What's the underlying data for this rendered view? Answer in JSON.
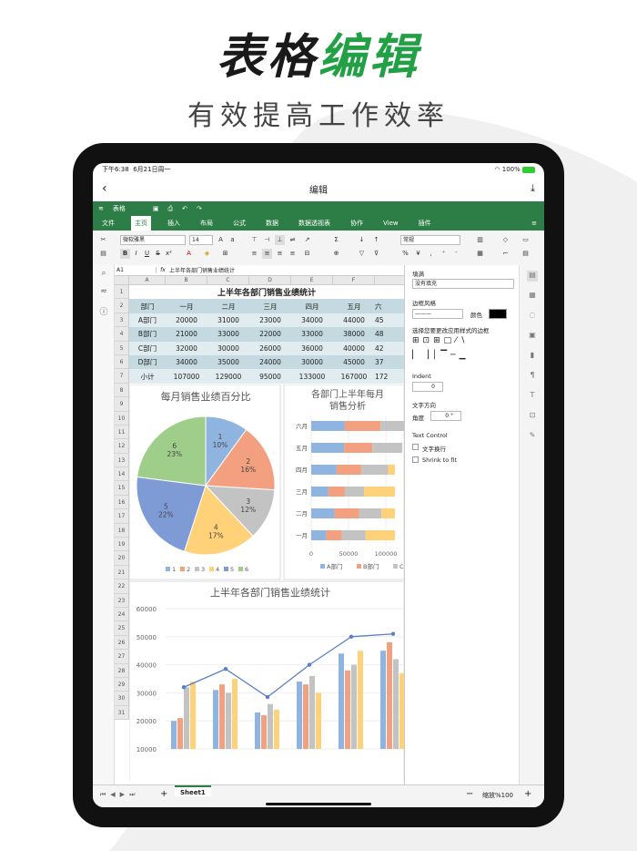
{
  "hero": {
    "title_black": "表格",
    "title_green": "编辑",
    "subtitle": "有效提高工作效率"
  },
  "status": {
    "time": "下午6:38",
    "date": "6月21日周一",
    "battery": "100%"
  },
  "nav": {
    "title": "编辑"
  },
  "app": {
    "name": "表格"
  },
  "ribbon_tabs": [
    "文件",
    "主页",
    "插入",
    "布局",
    "公式",
    "数据",
    "数据透视表",
    "协作",
    "View",
    "插件"
  ],
  "toolbar": {
    "font": "微软雅黑",
    "size": "14",
    "format": "常规"
  },
  "formula": {
    "cell": "A1",
    "fx": "fx",
    "value": "上半年各部门销售业绩统计"
  },
  "columns": [
    "A",
    "B",
    "C",
    "D",
    "E",
    "F"
  ],
  "rows": [
    "1",
    "2",
    "3",
    "4",
    "5",
    "6",
    "7",
    "8",
    "9",
    "10",
    "11",
    "12",
    "13",
    "14",
    "15",
    "16",
    "17",
    "18",
    "19",
    "20",
    "21",
    "22",
    "23",
    "24",
    "25",
    "26",
    "27",
    "28",
    "29",
    "30",
    "31"
  ],
  "table": {
    "title": "上半年各部门销售业绩统计",
    "header": [
      "部门",
      "一月",
      "二月",
      "三月",
      "四月",
      "五月",
      "六"
    ],
    "rows": [
      [
        "A部门",
        "20000",
        "31000",
        "23000",
        "34000",
        "44000",
        "45"
      ],
      [
        "B部门",
        "21000",
        "33000",
        "22000",
        "33000",
        "38000",
        "48"
      ],
      [
        "C部门",
        "32000",
        "30000",
        "26000",
        "36000",
        "40000",
        "42"
      ],
      [
        "D部门",
        "34000",
        "35000",
        "24000",
        "30000",
        "45000",
        "37"
      ],
      [
        "小计",
        "107000",
        "129000",
        "95000",
        "133000",
        "167000",
        "172"
      ]
    ]
  },
  "chart_data": [
    {
      "type": "pie",
      "title": "每月销售业绩百分比",
      "slices": [
        {
          "label": "1",
          "value": 10
        },
        {
          "label": "2",
          "value": 16
        },
        {
          "label": "3",
          "value": 12
        },
        {
          "label": "4",
          "value": 17
        },
        {
          "label": "5",
          "value": 22
        },
        {
          "label": "6",
          "value": 23
        }
      ],
      "legend": [
        "1",
        "2",
        "3",
        "4",
        "5",
        "6"
      ],
      "colors": [
        "#8fb4e0",
        "#f2a07f",
        "#c3c3c3",
        "#ffd27a",
        "#7f9bd6",
        "#9fce8b"
      ]
    },
    {
      "type": "bar",
      "title": "各部门上半年每月销售分析",
      "orientation": "horizontal",
      "stacked": true,
      "categories": [
        "六月",
        "五月",
        "四月",
        "三月",
        "二月",
        "一月"
      ],
      "series": [
        {
          "name": "A部门",
          "values": [
            45000,
            44000,
            34000,
            23000,
            31000,
            20000
          ]
        },
        {
          "name": "B部门",
          "values": [
            48000,
            38000,
            33000,
            22000,
            33000,
            21000
          ]
        },
        {
          "name": "C部门",
          "values": [
            42000,
            40000,
            36000,
            26000,
            30000,
            32000
          ]
        }
      ],
      "xticks": [
        "0",
        "50000",
        "100000"
      ],
      "colors": [
        "#8fb4e0",
        "#f2a07f",
        "#c3c3c3",
        "#ffd27a"
      ]
    },
    {
      "type": "bar",
      "title": "上半年各部门销售业绩统计",
      "categories": [
        "一月",
        "二月",
        "三月",
        "四月",
        "五月",
        "六月"
      ],
      "series": [
        {
          "name": "A部门",
          "values": [
            20000,
            31000,
            23000,
            34000,
            44000,
            45000
          ]
        },
        {
          "name": "B部门",
          "values": [
            21000,
            33000,
            22000,
            33000,
            38000,
            48000
          ]
        },
        {
          "name": "C部门",
          "values": [
            32000,
            30000,
            26000,
            36000,
            40000,
            42000
          ]
        },
        {
          "name": "D部门",
          "values": [
            34000,
            35000,
            24000,
            30000,
            45000,
            37000
          ]
        }
      ],
      "line": [
        32000,
        38500,
        28500,
        40000,
        50000,
        51000
      ],
      "yticks": [
        "60000",
        "50000",
        "40000",
        "30000",
        "20000",
        "10000"
      ],
      "ylim": [
        10000,
        60000
      ],
      "colors": [
        "#8fb4e0",
        "#f2a07f",
        "#c3c3c3",
        "#ffd27a"
      ],
      "line_color": "#5b7fc7"
    }
  ],
  "panel": {
    "fill": "填满",
    "fill_value": "没有填充",
    "border_style": "边框风格",
    "color": "颜色",
    "border_hint": "选择您要更改应用样式的边框",
    "indent": "Indent",
    "indent_value": "0",
    "text_dir": "文字方向",
    "angle": "角度",
    "angle_value": "0 °",
    "text_control": "Text Control",
    "wrap": "文字换行",
    "shrink": "Shrink to fit"
  },
  "bottom": {
    "sheet": "Sheet1",
    "zoom": "缩放%100"
  }
}
